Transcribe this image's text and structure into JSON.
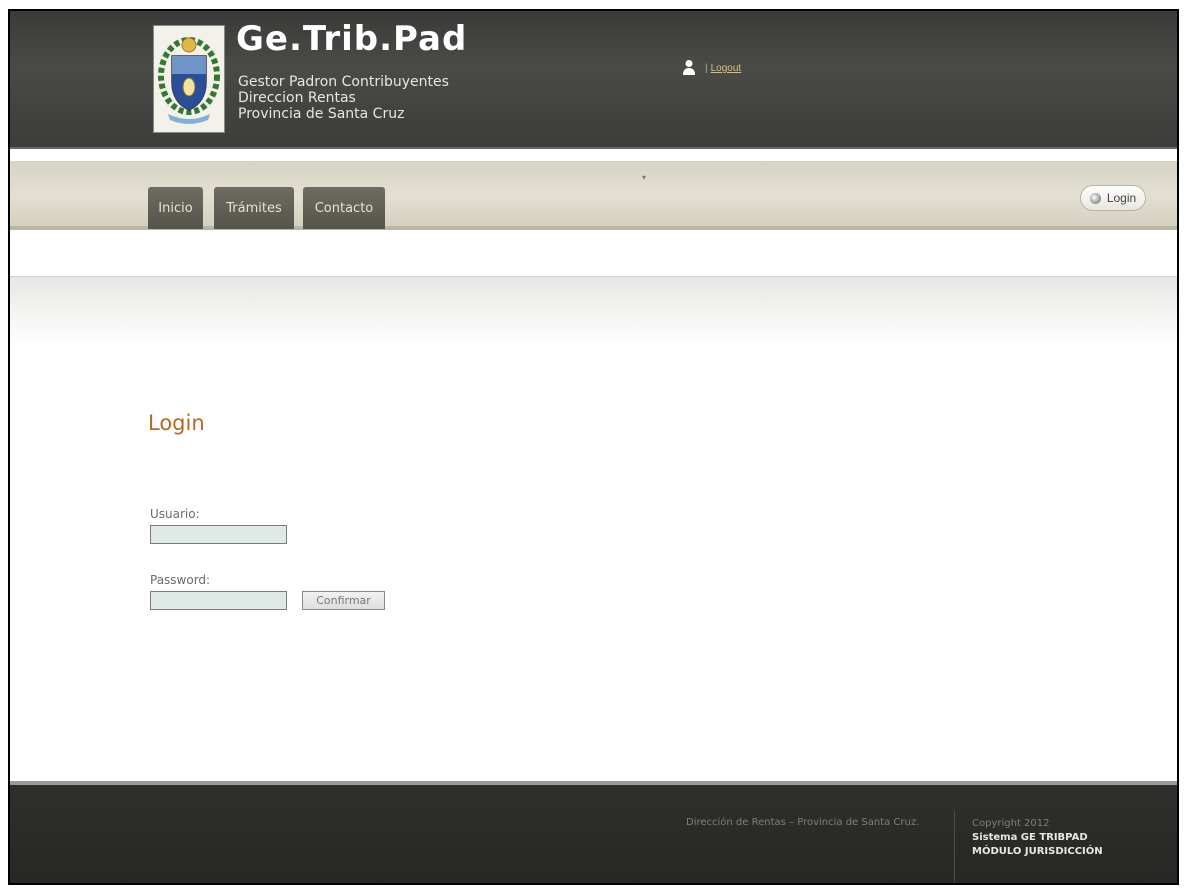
{
  "header": {
    "brand_title": "Ge.Trib.Pad",
    "subtitle_lines": [
      "Gestor Padron Contribuyentes",
      "Direccion Rentas",
      "Provincia de Santa Cruz"
    ],
    "user_icon": "user-icon",
    "separator": "|",
    "logout_label": "Logout"
  },
  "nav": {
    "tabs": [
      {
        "label": "Inicio"
      },
      {
        "label": "Trámites"
      },
      {
        "label": "Contacto"
      }
    ],
    "dropdown_glyph": "▾",
    "login_button_label": "Login",
    "login_icon": "power-icon"
  },
  "main": {
    "heading": "Login",
    "usuario_label": "Usuario:",
    "usuario_value": "",
    "password_label": "Password:",
    "password_value": "",
    "confirm_label": "Confirmar"
  },
  "footer": {
    "left_text": "Dirección de Rentas – Provincia de Santa Cruz.",
    "copyright": "Copyright 2012",
    "system_name": "Sistema GE TRIBPAD",
    "module_name": "MÓDULO JURISDICCIÓN"
  },
  "colors": {
    "accent_heading": "#b56a1f",
    "header_bg": "#3f3f3d",
    "nav_bg": "#dcd9ca",
    "tab_bg": "#5e5d55",
    "input_bg": "#dfe9e6",
    "footer_bg": "#2b2b29"
  }
}
